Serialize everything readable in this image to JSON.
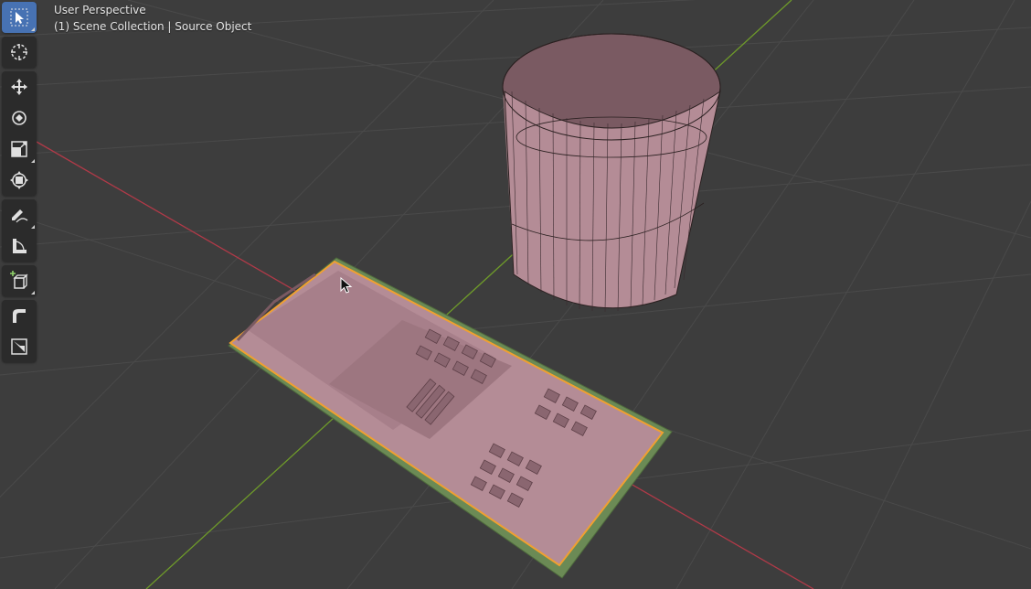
{
  "viewport": {
    "view_name": "User Perspective",
    "context": "(1) Scene Collection | Source Object"
  },
  "toolbar": {
    "tools": [
      {
        "name": "select-box",
        "active": true
      },
      {
        "name": "cursor"
      },
      {
        "name": "move"
      },
      {
        "name": "rotate"
      },
      {
        "name": "scale"
      },
      {
        "name": "transform"
      },
      {
        "name": "annotate"
      },
      {
        "name": "measure"
      },
      {
        "name": "add-cube"
      },
      {
        "name": "bevel"
      },
      {
        "name": "shear"
      }
    ]
  },
  "colors": {
    "background": "#3d3d3d",
    "grid": "#4a4a4a",
    "x_axis": "#b03a48",
    "y_axis": "#6e9a2a",
    "object": "#b48c96",
    "selection_outline": "#f0a030",
    "active_tool": "#4772b3"
  }
}
